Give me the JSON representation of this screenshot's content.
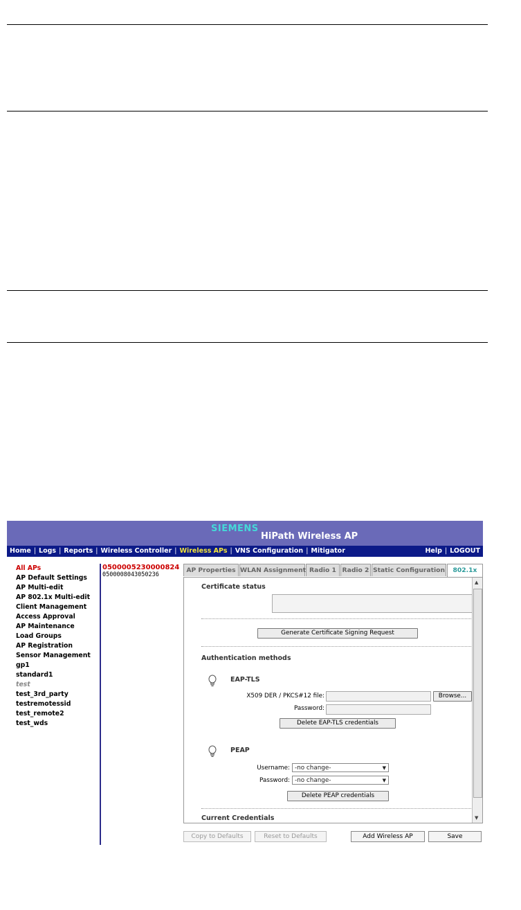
{
  "brand": {
    "logo": "SIEMENS",
    "title": "HiPath Wireless AP"
  },
  "nav": {
    "left": [
      "Home",
      "Logs",
      "Reports",
      "Wireless Controller",
      "Wireless APs",
      "VNS Configuration",
      "Mitigator"
    ],
    "right": [
      "Help",
      "LOGOUT"
    ],
    "active": "Wireless APs"
  },
  "sidebar": {
    "items": [
      "All APs",
      "AP Default Settings",
      "AP Multi-edit",
      "AP 802.1x Multi-edit",
      "Client Management",
      "Access Approval",
      "AP Maintenance",
      "Load Groups",
      "AP Registration",
      "Sensor Management",
      "gp1",
      "standard1",
      "test",
      "test_3rd_party",
      "testremotessid",
      "test_remote2",
      "test_wds"
    ],
    "active": "All APs"
  },
  "ap_list": [
    "0500005230000824",
    "0500008043050236"
  ],
  "tabs": [
    "AP Properties",
    "WLAN Assignment",
    "Radio 1",
    "Radio 2",
    "Static Configuration",
    "802.1x"
  ],
  "active_tab": "802.1x",
  "panel": {
    "cert_status_heading": "Certificate status",
    "gen_csr_button": "Generate Certificate Signing Request",
    "auth_methods_heading": "Authentication methods",
    "eap_tls": {
      "title": "EAP-TLS",
      "file_label": "X509 DER / PKCS#12 file:",
      "browse_button": "Browse...",
      "password_label": "Password:",
      "delete_button": "Delete EAP-TLS credentials"
    },
    "peap": {
      "title": "PEAP",
      "username_label": "Username:",
      "username_value": "-no change-",
      "password_label": "Password:",
      "password_value": "-no change-",
      "delete_button": "Delete PEAP credentials"
    },
    "current_credentials_heading": "Current Credentials"
  },
  "bottom": {
    "copy_defaults": "Copy to Defaults",
    "reset_defaults": "Reset to Defaults",
    "add_ap": "Add Wireless AP",
    "save": "Save"
  }
}
